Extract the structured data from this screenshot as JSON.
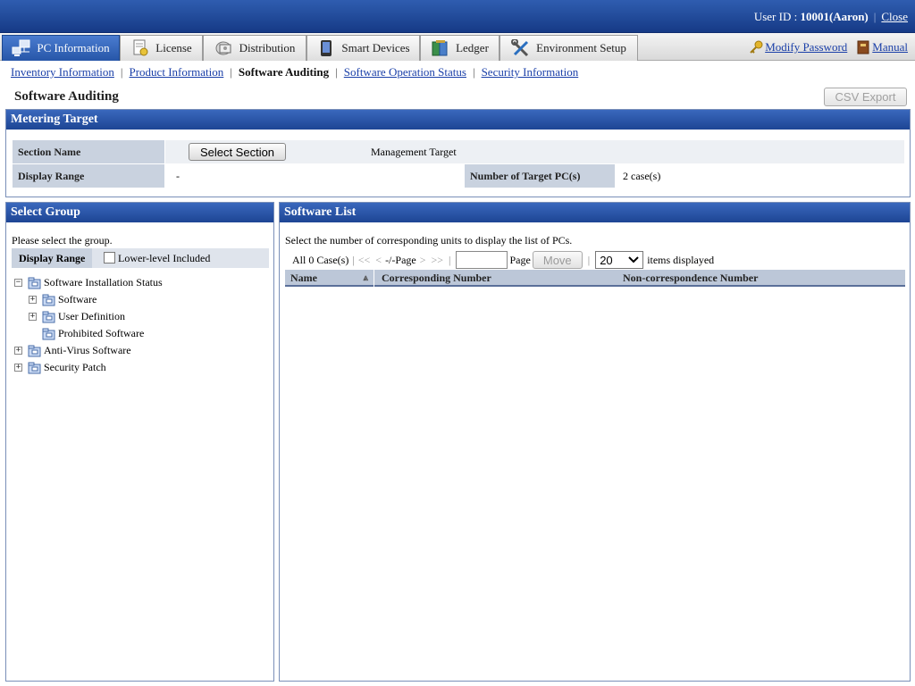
{
  "header": {
    "user_label": "User ID : ",
    "user_id": "10001(Aaron)",
    "close": "Close"
  },
  "tabs": [
    {
      "label": "PC Information",
      "icon": "pc-network-icon",
      "active": true
    },
    {
      "label": "License",
      "icon": "license-icon"
    },
    {
      "label": "Distribution",
      "icon": "distribution-icon"
    },
    {
      "label": "Smart Devices",
      "icon": "smart-device-icon"
    },
    {
      "label": "Ledger",
      "icon": "ledger-icon"
    },
    {
      "label": "Environment Setup",
      "icon": "tools-icon"
    }
  ],
  "top_links": {
    "modify_password": "Modify Password",
    "manual": "Manual"
  },
  "subnav": {
    "inventory": "Inventory Information",
    "product": "Product Information",
    "auditing": "Software Auditing",
    "operation": "Software Operation Status",
    "security": "Security Information"
  },
  "page": {
    "title": "Software Auditing",
    "csv_export": "CSV Export"
  },
  "metering": {
    "title": "Metering Target",
    "section_name_label": "Section Name",
    "select_section": "Select Section",
    "management_target": "Management Target",
    "display_range_label": "Display Range",
    "display_range_value": "-",
    "target_pc_label": "Number of Target PC(s)",
    "target_pc_value": "2 case(s)"
  },
  "group": {
    "title": "Select Group",
    "hint": "Please select the group.",
    "display_range_label": "Display Range",
    "lower_level": "Lower-level Included",
    "tree": {
      "sis": "Software Installation Status",
      "software": "Software",
      "user_def": "User Definition",
      "prohibited": "Prohibited Software",
      "antivirus": "Anti-Virus Software",
      "patch": "Security Patch"
    }
  },
  "software_list": {
    "title": "Software List",
    "hint": "Select the number of corresponding units to display the list of PCs.",
    "all_count": "All 0 Case(s)",
    "nav_first": "<<",
    "nav_prev": "<",
    "nav_page": "-/-Page",
    "nav_next": ">",
    "nav_last": ">>",
    "page_label": "Page",
    "move": "Move",
    "per_page": "20",
    "items_displayed": "items displayed",
    "columns": {
      "name": "Name",
      "corresponding": "Corresponding Number",
      "non_correspondence": "Non-correspondence Number"
    }
  }
}
